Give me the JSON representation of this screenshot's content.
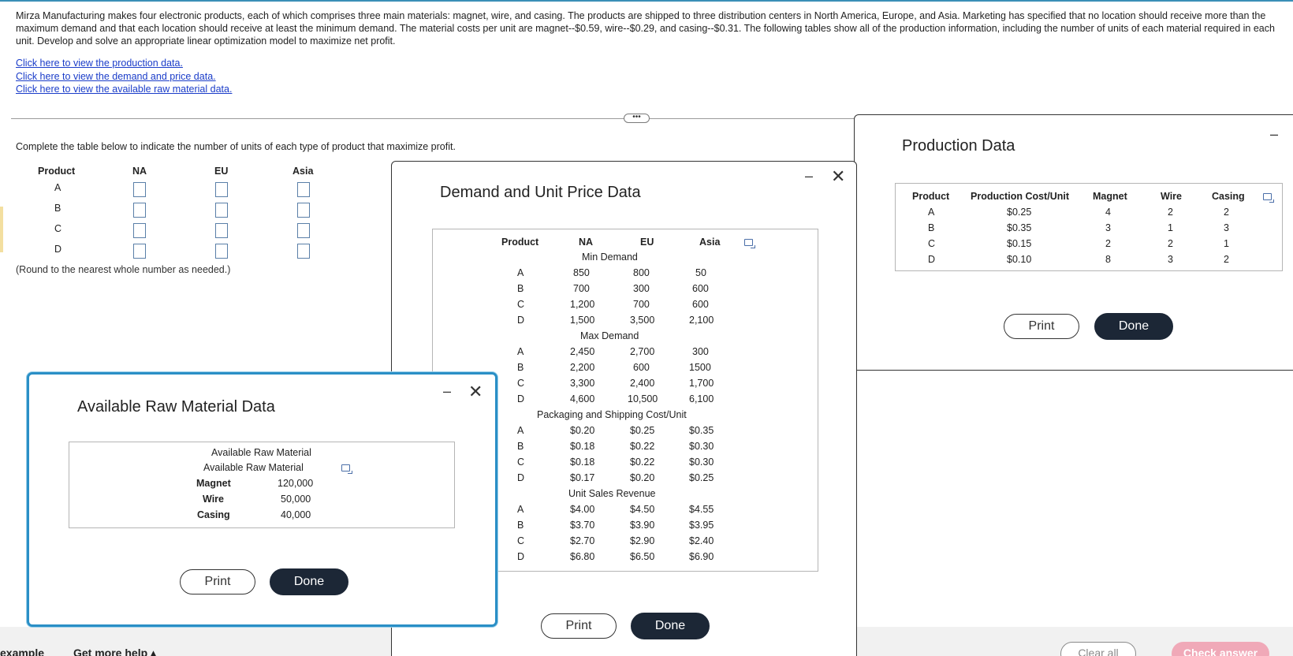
{
  "question": {
    "text": "Mirza Manufacturing makes four electronic products, each of which comprises three main materials: magnet, wire, and casing. The products are shipped to three distribution centers in North America, Europe, and Asia. Marketing has specified that no location should receive more than the maximum demand and that each location should receive at least the minimum demand. The material costs per unit are magnet--$0.59, wire--$0.29, and casing--$0.31. The following tables show all of the production information, including the number of units of each material required in each unit. Develop and solve an appropriate linear optimization model to maximize net profit.",
    "links": [
      "Click here to view the production data.",
      "Click here to view the demand and price data.",
      "Click here to view the available raw material data."
    ],
    "more_label": "•••"
  },
  "answer": {
    "instruction": "Complete the table below to indicate the number of units of each type of product that maximize profit.",
    "headers": [
      "Product",
      "NA",
      "EU",
      "Asia"
    ],
    "products": [
      "A",
      "B",
      "C",
      "D"
    ],
    "note": "(Round to the nearest whole number as needed.)"
  },
  "production_dialog": {
    "title": "Production Data",
    "minimize": "–",
    "headers": [
      "Product",
      "Production Cost/Unit",
      "Magnet",
      "Wire",
      "Casing"
    ],
    "rows": [
      [
        "A",
        "$0.25",
        "4",
        "2",
        "2"
      ],
      [
        "B",
        "$0.35",
        "3",
        "1",
        "3"
      ],
      [
        "C",
        "$0.15",
        "2",
        "2",
        "1"
      ],
      [
        "D",
        "$0.10",
        "8",
        "3",
        "2"
      ]
    ],
    "print_label": "Print",
    "done_label": "Done"
  },
  "demand_dialog": {
    "title": "Demand and Unit Price Data",
    "minimize": "–",
    "close": "✕",
    "headers": [
      "Product",
      "NA",
      "EU",
      "Asia"
    ],
    "sections": [
      {
        "label": "Min Demand",
        "rows": [
          [
            "A",
            "850",
            "800",
            "50"
          ],
          [
            "B",
            "700",
            "300",
            "600"
          ],
          [
            "C",
            "1,200",
            "700",
            "600"
          ],
          [
            "D",
            "1,500",
            "3,500",
            "2,100"
          ]
        ]
      },
      {
        "label": "Max Demand",
        "rows": [
          [
            "A",
            "2,450",
            "2,700",
            "300"
          ],
          [
            "B",
            "2,200",
            "600",
            "1500"
          ],
          [
            "C",
            "3,300",
            "2,400",
            "1,700"
          ],
          [
            "D",
            "4,600",
            "10,500",
            "6,100"
          ]
        ]
      },
      {
        "label": "Packaging and Shipping Cost/Unit",
        "rows": [
          [
            "A",
            "$0.20",
            "$0.25",
            "$0.35"
          ],
          [
            "B",
            "$0.18",
            "$0.22",
            "$0.30"
          ],
          [
            "C",
            "$0.18",
            "$0.22",
            "$0.30"
          ],
          [
            "D",
            "$0.17",
            "$0.20",
            "$0.25"
          ]
        ]
      },
      {
        "label": "Unit Sales Revenue",
        "rows": [
          [
            "A",
            "$4.00",
            "$4.50",
            "$4.55"
          ],
          [
            "B",
            "$3.70",
            "$3.90",
            "$3.95"
          ],
          [
            "C",
            "$2.70",
            "$2.90",
            "$2.40"
          ],
          [
            "D",
            "$6.80",
            "$6.50",
            "$6.90"
          ]
        ]
      }
    ],
    "print_label": "Print",
    "done_label": "Done"
  },
  "raw_dialog": {
    "title": "Available Raw Material Data",
    "minimize": "–",
    "close": "✕",
    "caption1": "Available Raw Material",
    "caption2": "Available Raw Material",
    "rows": [
      [
        "Magnet",
        "120,000"
      ],
      [
        "Wire",
        "50,000"
      ],
      [
        "Casing",
        "40,000"
      ]
    ],
    "print_label": "Print",
    "done_label": "Done"
  },
  "footer": {
    "example_label": "example",
    "help_label": "Get more help ▴",
    "clear_label": "Clear all",
    "check_label": "Check answer"
  },
  "colors": {
    "link": "#1a3cc9",
    "input_border": "#5a7fa8",
    "dark_button": "#1c2736",
    "check_button": "#f0a9b8",
    "raw_dialog_border": "#2a8fc6"
  }
}
